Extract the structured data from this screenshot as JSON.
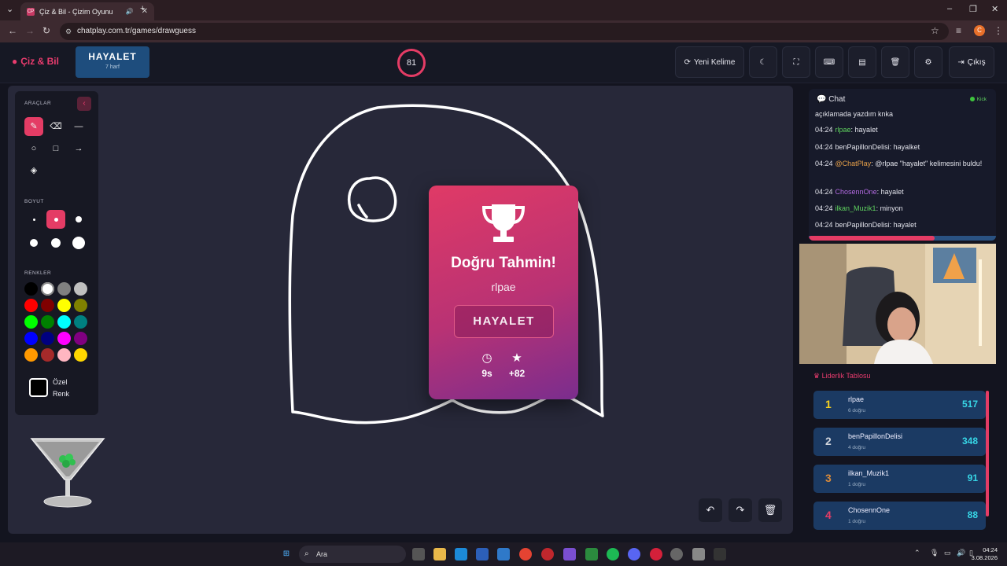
{
  "browser": {
    "tab_title": "Çiz & Bil - Çizim Oyunu",
    "favicon_text": "CP",
    "url": "chatplay.com.tr/games/drawguess",
    "profile_initial": "C"
  },
  "header": {
    "logo": "Çiz & Bil",
    "word": "HAYALET",
    "word_hint": "7 harf",
    "timer": "81",
    "new_word_label": "Yeni Kelime",
    "exit_label": "Çıkış"
  },
  "tools": {
    "tools_label": "ARAÇLAR",
    "size_label": "BOYUT",
    "colors_label": "RENKLER",
    "custom_color_label_1": "Özel",
    "custom_color_label_2": "Renk",
    "palette": [
      "#000000",
      "#ffffff",
      "#808080",
      "#c0c0c0",
      "#ff0000",
      "#800000",
      "#ffff00",
      "#808000",
      "#00ff00",
      "#008000",
      "#00ffff",
      "#008080",
      "#0000ff",
      "#000080",
      "#ff00ff",
      "#800080",
      "#ff9900",
      "#a52a2a",
      "#ffb6c1",
      "#ffd700"
    ]
  },
  "result": {
    "title": "Doğru Tahmin!",
    "player": "rlpae",
    "word": "HAYALET",
    "time": "9s",
    "points": "+82"
  },
  "chat": {
    "title": "Chat",
    "platform": "Kick",
    "messages": [
      {
        "time": "",
        "user": "",
        "text": "açıklamada yazdım knka",
        "color": "#e1e2ea"
      },
      {
        "time": "04:24",
        "user": "rlpae",
        "text": ": hayalet",
        "color": "#5fd35f"
      },
      {
        "time": "04:24",
        "user": "benPapillonDelisi",
        "text": ": hayalket",
        "color": "#e1e2ea"
      },
      {
        "time": "04:24",
        "user": "@ChatPlay",
        "text": ": @rlpae \"hayalet\" kelimesini buldu!",
        "color": "#e6a04a"
      },
      {
        "time": "04:24",
        "user": "ChosennOne",
        "text": ": hayalet",
        "color": "#b26ae0"
      },
      {
        "time": "04:24",
        "user": "ilkan_Muzik1",
        "text": ": minyon",
        "color": "#5fd35f"
      },
      {
        "time": "04:24",
        "user": "benPapillonDelisi",
        "text": ": hayalet",
        "color": "#e1e2ea"
      }
    ]
  },
  "leaderboard": {
    "title": "Liderlik Tablosu",
    "rows": [
      {
        "rank": "1",
        "name": "rlpae",
        "sub": "6 doğru",
        "score": "517",
        "color": "#f5d020"
      },
      {
        "rank": "2",
        "name": "benPapillonDelisi",
        "sub": "4 doğru",
        "score": "348",
        "color": "#d0d4dc"
      },
      {
        "rank": "3",
        "name": "ilkan_Muzik1",
        "sub": "1 doğru",
        "score": "91",
        "color": "#d98a3a"
      },
      {
        "rank": "4",
        "name": "ChosennOne",
        "sub": "1 doğru",
        "score": "88",
        "color": "#e43c65"
      }
    ]
  },
  "taskbar": {
    "search": "Ara",
    "time": "04:24",
    "date": "3.08.2026"
  }
}
